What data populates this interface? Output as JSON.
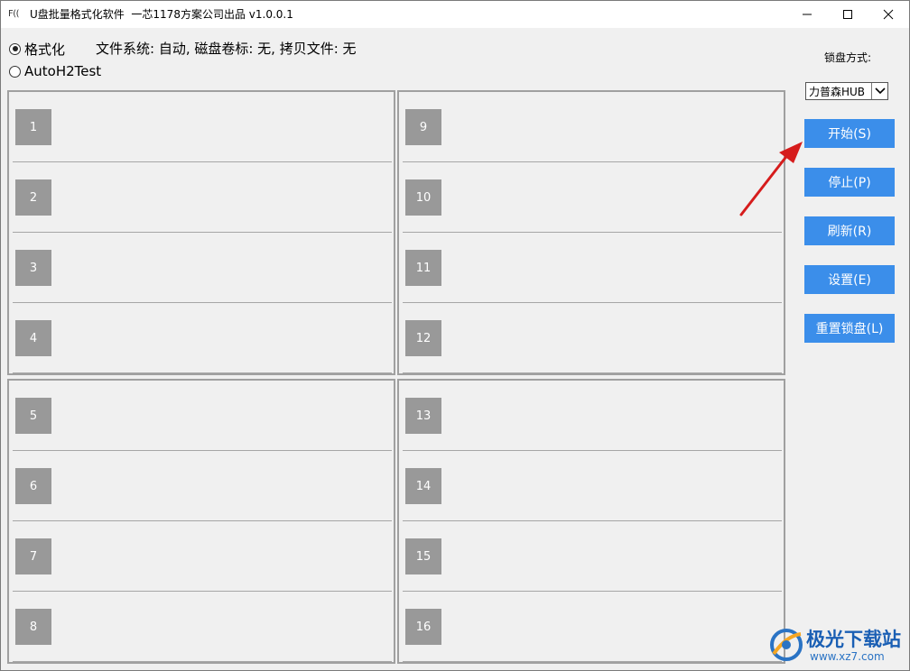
{
  "titlebar": {
    "icon_text": "F((",
    "title": "U盘批量格式化软件  一芯1178方案公司出品 v1.0.0.1"
  },
  "mode": {
    "options": [
      {
        "label": "格式化",
        "checked": true
      },
      {
        "label": "AutoH2Test",
        "checked": false
      }
    ],
    "fs_info": "文件系统: 自动, 磁盘卷标: 无, 拷贝文件: 无"
  },
  "slots": {
    "group1": [
      "1",
      "2",
      "3",
      "4"
    ],
    "group2": [
      "9",
      "10",
      "11",
      "12"
    ],
    "group3": [
      "5",
      "6",
      "7",
      "8"
    ],
    "group4": [
      "13",
      "14",
      "15",
      "16"
    ]
  },
  "sidebar": {
    "lock_label": "锁盘方式:",
    "lock_value": "力普森HUB",
    "buttons": [
      {
        "label": "开始(S)"
      },
      {
        "label": "停止(P)"
      },
      {
        "label": "刷新(R)"
      },
      {
        "label": "设置(E)"
      },
      {
        "label": "重置锁盘(L)"
      }
    ],
    "accent": "#3b8eea"
  },
  "watermark": {
    "text_cn": "极光下载站",
    "text_url": "www.xz7.com"
  }
}
